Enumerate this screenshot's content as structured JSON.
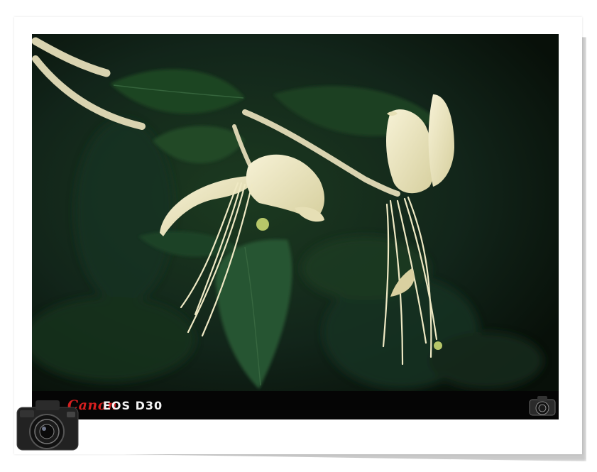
{
  "caption": {
    "brand": "Canon",
    "model": "EOS D30"
  },
  "colors": {
    "background": "#0d1710",
    "leaf": "#1f4424",
    "petal": "#efe9c4",
    "caption_bar": "#050505",
    "brand_red": "#d51f1f"
  },
  "icons": [
    "camera-icon",
    "small-camera-icon"
  ]
}
